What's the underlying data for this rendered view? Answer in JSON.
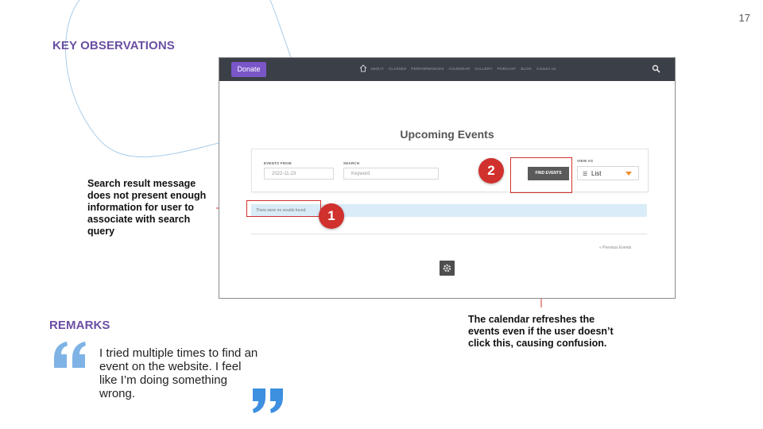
{
  "slide": {
    "number": "17",
    "key_observations_heading": "KEY OBSERVATIONS",
    "remarks_heading": "REMARKS"
  },
  "screenshot": {
    "nav": {
      "donate_label": "Donate",
      "links": [
        "ABOUT",
        "CLASSES",
        "PERFORMANCES",
        "CALENDAR",
        "GALLERY",
        "PODCAST",
        "BLOG",
        "Contact Us"
      ]
    },
    "title": "Upcoming Events",
    "filters": {
      "events_from_label": "EVENTS FROM",
      "events_from_value": "2022-11-23",
      "search_label": "SEARCH",
      "search_placeholder": "Keyword",
      "find_button_label": "FIND EVENTS",
      "view_as_label": "VIEW AS",
      "view_as_value": "List"
    },
    "notice": "There were no results found.",
    "previous_events_label": "« Previous Events"
  },
  "annotations": {
    "badge_1": "1",
    "badge_2": "2",
    "left_callout": "Search result message does not present enough information for user to associate with search query",
    "right_callout": "The calendar refreshes the events even if the user doesn’t click this, causing confusion."
  },
  "remark": {
    "quote": "I tried multiple times to find an event on the website. I feel like I’m doing something wrong."
  },
  "colors": {
    "accent_purple": "#6a4fa3",
    "annotation_red": "#d0312d",
    "quote_blue": "#7fb3e6",
    "decor_line": "#a9cce8"
  }
}
